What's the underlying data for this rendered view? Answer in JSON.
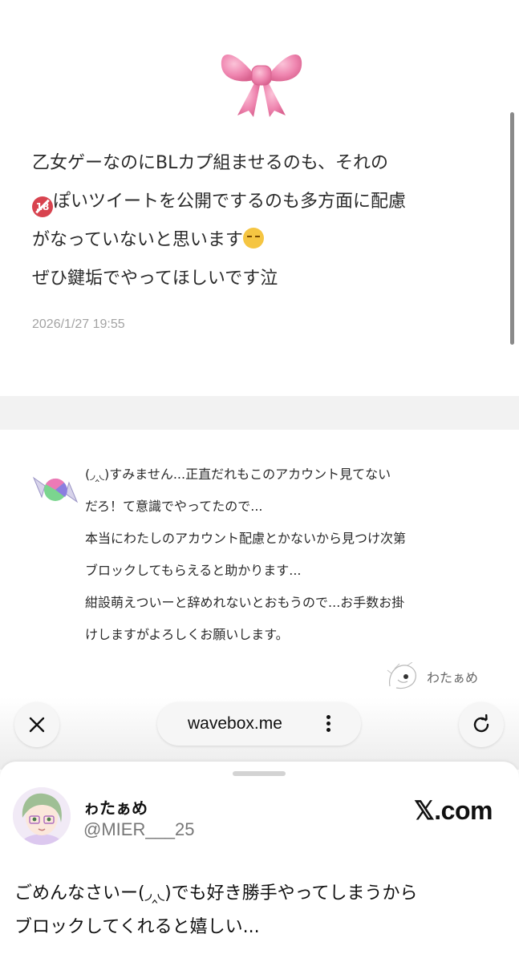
{
  "message": {
    "lines": [
      "乙女ゲーなのにBLカプ組ませるのも、それの",
      "ぽいツイートを公開でするのも多方面に配慮",
      "がなっていないと思います",
      "ぜひ鍵垢でやってほしいです泣"
    ],
    "timestamp": "2026/1/27 19:55"
  },
  "reply": {
    "lines": [
      "(◞‸◟)すみません...正直だれもこのアカウント見てない",
      "だろ！て意識でやってたので...",
      "本当にわたしのアカウント配慮とかないから見つけ次第",
      "ブロックしてもらえると助かります...",
      "紺設萌えついーと辞めれないとおもうので...お手数お掛",
      "けしますがよろしくお願いします。"
    ],
    "signature": "わたぁめ"
  },
  "browser": {
    "url": "wavebox.me"
  },
  "tweet_sheet": {
    "display_name": "ゎたぁめ",
    "handle": "@MIER___25",
    "brand": "𝕏.com",
    "lines": [
      "ごめんなさいー(◞‸◟)でも好き勝手やってしまうから",
      "ブロックしてくれると嬉しい..."
    ]
  },
  "colors": {
    "ribbon": "#f08cb4",
    "timestamp": "#a3a3a3",
    "band": "#f2f2f2"
  }
}
